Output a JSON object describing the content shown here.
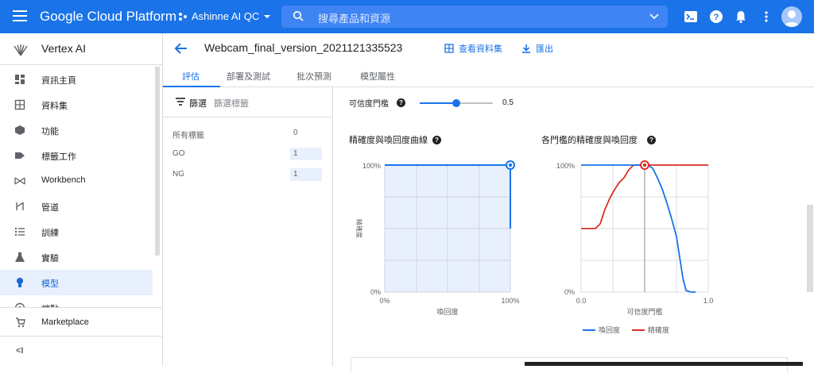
{
  "topbar": {
    "brand": "Google Cloud Platform",
    "project": "Ashinne AI QC",
    "search_placeholder": "搜尋產品和資源",
    "icons": [
      "cloud-shell-icon",
      "help-icon",
      "notifications-icon",
      "more-vert-icon",
      "account-avatar-icon"
    ],
    "accent": "#1a73e8"
  },
  "sidebar": {
    "title": "Vertex AI",
    "items": [
      {
        "label": "資訊主頁",
        "icon": "dashboard-icon"
      },
      {
        "label": "資料集",
        "icon": "dataset-icon"
      },
      {
        "label": "功能",
        "icon": "features-icon"
      },
      {
        "label": "標籤工作",
        "icon": "label-icon"
      },
      {
        "label": "Workbench",
        "icon": "workbench-icon"
      },
      {
        "label": "管道",
        "icon": "pipelines-icon"
      },
      {
        "label": "訓練",
        "icon": "training-icon"
      },
      {
        "label": "實驗",
        "icon": "experiments-icon"
      },
      {
        "label": "模型",
        "icon": "models-icon"
      },
      {
        "label": "端點",
        "icon": "endpoints-icon"
      }
    ],
    "active_index": 8,
    "marketplace": "Marketplace",
    "collapse": "<I"
  },
  "page": {
    "title": "Webcam_final_version_2021121335523",
    "view_dataset": "查看資料集",
    "export": "匯出"
  },
  "tabs": [
    "評估",
    "部署及測試",
    "批次預測",
    "模型屬性"
  ],
  "filter": {
    "label": "篩選",
    "placeholder": "篩選標籤",
    "rows": [
      {
        "name": "所有標籤",
        "value": "0"
      },
      {
        "name": "GO",
        "value": "1"
      },
      {
        "name": "NG",
        "value": "1"
      }
    ]
  },
  "threshold": {
    "label": "可信度門檻",
    "value": "0.5",
    "fraction": 0.5
  },
  "pr_chart": {
    "title": "精確度與喚回度曲線",
    "y_top": "100%",
    "y_bottom": "0%",
    "x_left": "0%",
    "x_right": "100%",
    "xlabel": "喚回度",
    "ylabel": "精確度"
  },
  "thr_chart": {
    "title": "各門檻的精確度與喚回度",
    "y_top": "100%",
    "y_bottom": "0%",
    "x_left": "0.0",
    "x_right": "1.0",
    "xlabel": "可信度門檻",
    "legend_recall": "喚回度",
    "legend_precision": "精確度",
    "recall_color": "#1a73e8",
    "precision_color": "#d93025"
  }
}
